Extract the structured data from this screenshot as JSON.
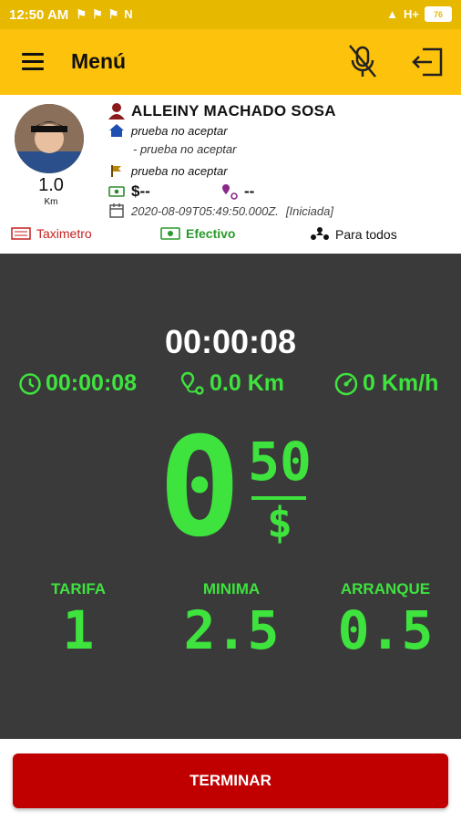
{
  "status_bar": {
    "time": "12:50 AM",
    "network": "H+",
    "battery": "76"
  },
  "app_bar": {
    "title": "Menú"
  },
  "trip_info": {
    "distance_value": "1.0",
    "distance_unit": "Km",
    "passenger_name": "ALLEINY MACHADO SOSA",
    "origin": "prueba no aceptar",
    "origin_detail": "- prueba no aceptar",
    "destination": "prueba no aceptar",
    "price": "$--",
    "distance_est": "--",
    "datetime": "2020-08-09T05:49:50.000Z.",
    "trip_status": "[Iniciada]"
  },
  "options": {
    "taximeter": "Taximetro",
    "payment": "Efectivo",
    "audience": "Para todos"
  },
  "meter": {
    "elapsed": "00:00:08",
    "timer": "00:00:08",
    "distance": "0.0 Km",
    "speed": "0 Km/h",
    "fare_integer": "0",
    "fare_cents": "50",
    "currency": "$",
    "tarifa_label": "TARIFA",
    "tarifa_value": "1",
    "minima_label": "MINIMA",
    "minima_value": "2.5",
    "arranque_label": "ARRANQUE",
    "arranque_value": "0.5"
  },
  "actions": {
    "finish": "TERMINAR"
  },
  "colors": {
    "app_bar": "#fdc20b",
    "panel": "#3a3a3a",
    "digits": "#3ee33e",
    "finish_button": "#c00000"
  }
}
